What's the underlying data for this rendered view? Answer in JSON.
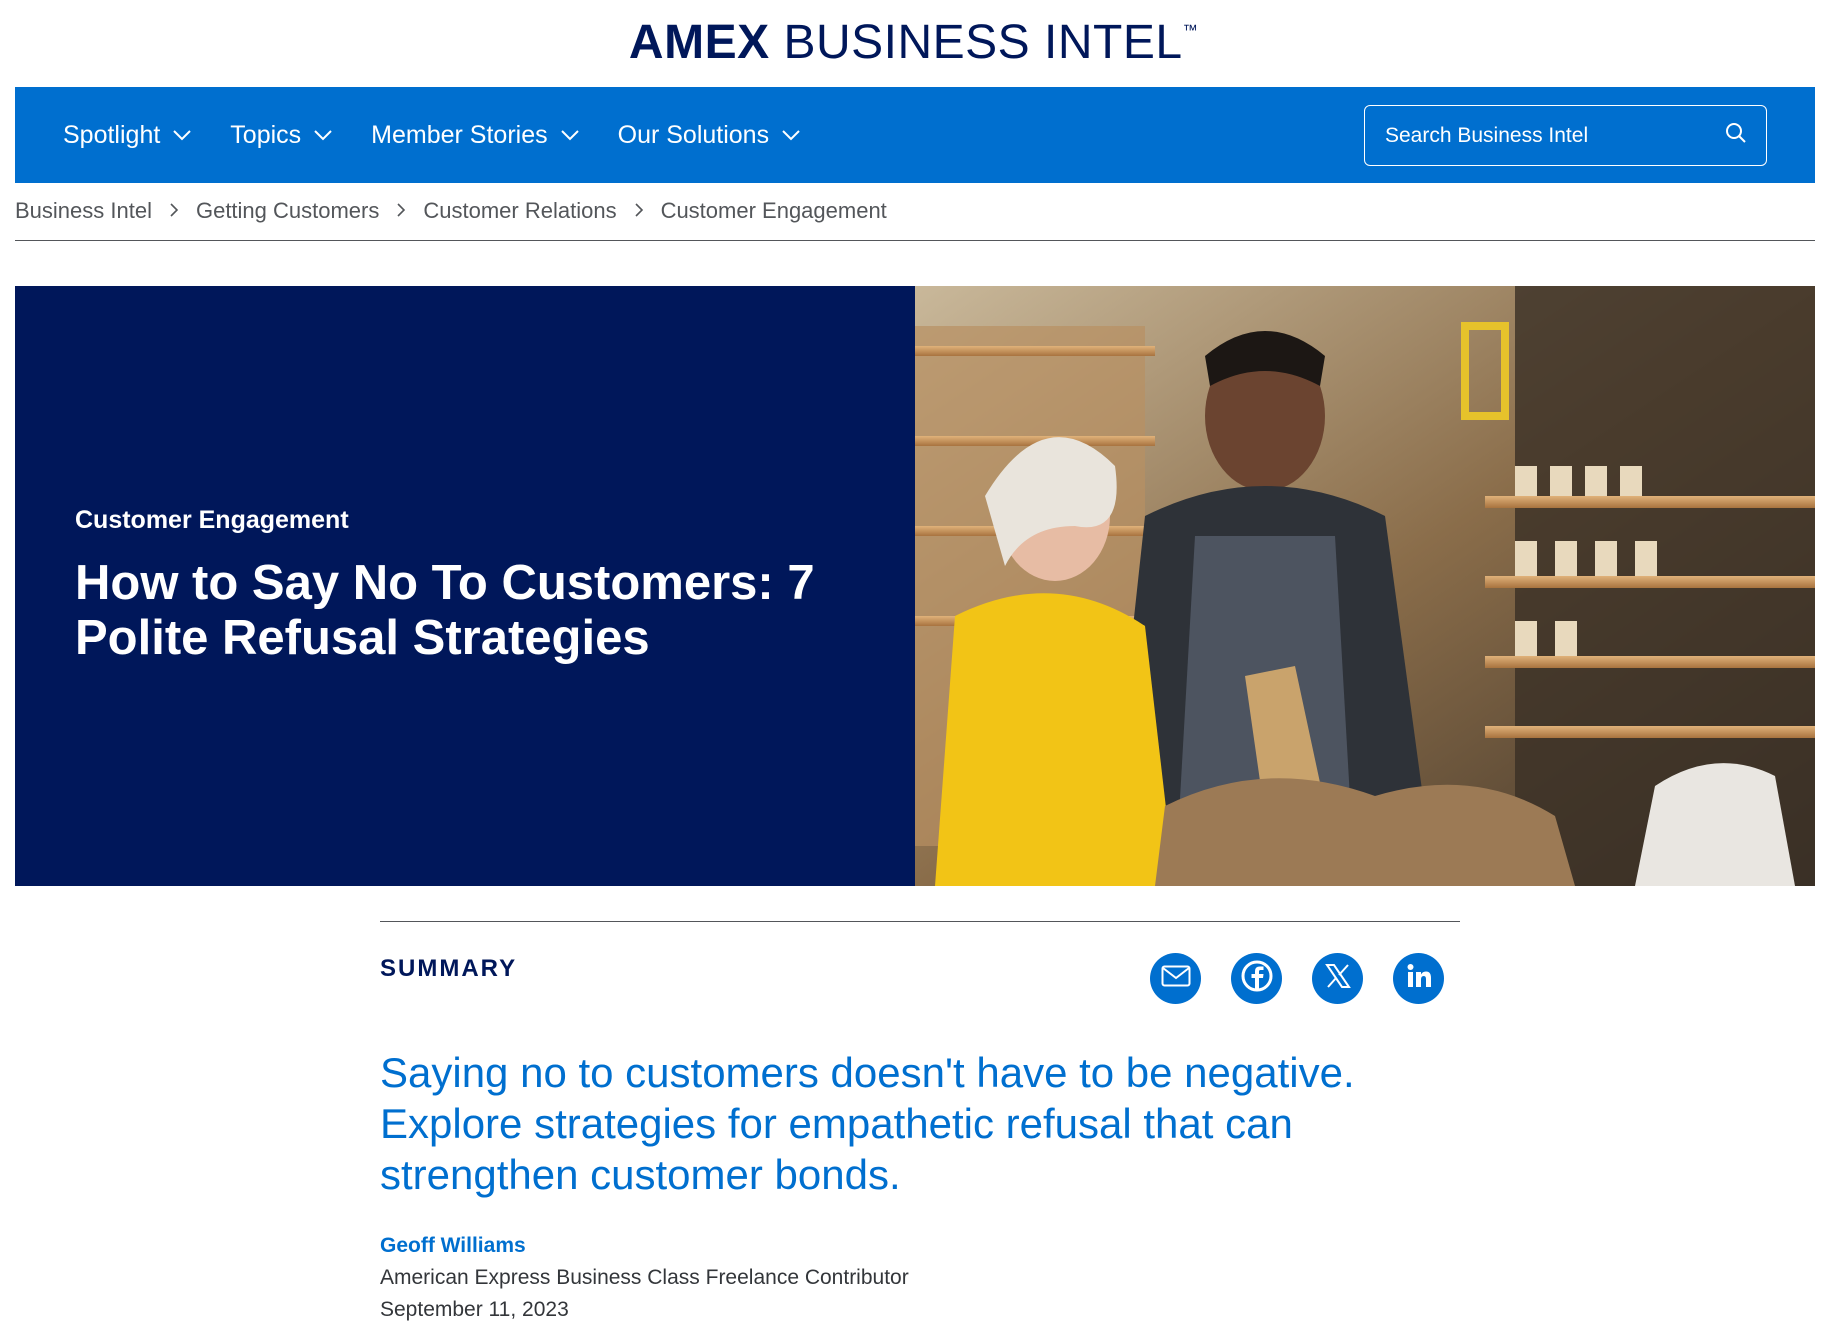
{
  "logo": {
    "brand": "AMEX",
    "name": "BUSINESS INTEL",
    "trademark": "™"
  },
  "nav": {
    "items": [
      {
        "label": "Spotlight"
      },
      {
        "label": "Topics"
      },
      {
        "label": "Member Stories"
      },
      {
        "label": "Our Solutions"
      }
    ],
    "search_placeholder": "Search Business Intel"
  },
  "breadcrumb": [
    "Business Intel",
    "Getting Customers",
    "Customer Relations",
    "Customer Engagement"
  ],
  "hero": {
    "category": "Customer Engagement",
    "title": "How to Say No To Customers: 7 Polite Refusal Strategies"
  },
  "summary": {
    "label": "SUMMARY",
    "share_icons": [
      "mail-icon",
      "facebook-icon",
      "x-icon",
      "linkedin-icon"
    ],
    "dek": "Saying no to customers doesn't have to be negative. Explore strategies for empathetic refusal that can strengthen customer bonds."
  },
  "author": {
    "name": "Geoff Williams",
    "role": "American Express Business Class Freelance Contributor",
    "date": "September 11, 2023"
  },
  "colors": {
    "brand_blue": "#006fcf",
    "navy": "#00175a"
  }
}
